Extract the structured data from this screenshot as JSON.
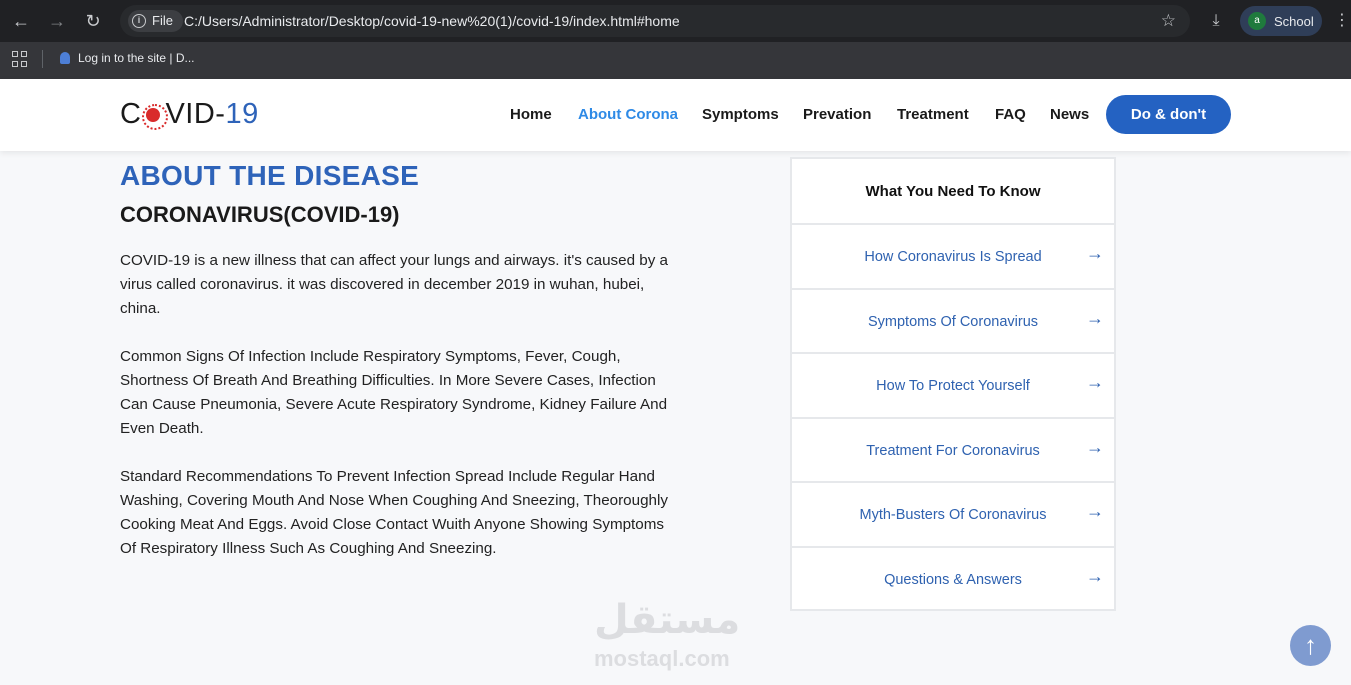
{
  "browser": {
    "site_chip": "File",
    "url": "C:/Users/Administrator/Desktop/covid-19-new%20(1)/covid-19/index.html#home",
    "profile_initial": "a",
    "profile_name": "School",
    "bookmark": "Log in to the site | D..."
  },
  "header": {
    "logo_prefix": "C",
    "logo_mid": "VID-",
    "logo_suffix": "19",
    "nav": [
      "Home",
      "About Corona",
      "Symptoms",
      "Prevation",
      "Treatment",
      "FAQ",
      "News"
    ],
    "active_nav": "About Corona",
    "cta": "Do & don't"
  },
  "main": {
    "heading": "ABOUT THE DISEASE",
    "subheading": "CORONAVIRUS(COVID-19)",
    "paragraphs": [
      "COVID-19 is a new illness that can affect your lungs and airways. it's caused by a virus called coronavirus. it was discovered in december 2019 in wuhan, hubei, china.",
      "Common Signs Of Infection Include Respiratory Symptoms, Fever, Cough, Shortness Of Breath And Breathing Difficulties. In More Severe Cases, Infection Can Cause Pneumonia, Severe Acute Respiratory Syndrome, Kidney Failure And Even Death.",
      "Standard Recommendations To Prevent Infection Spread Include Regular Hand Washing, Covering Mouth And Nose When Coughing And Sneezing, Theoroughly Cooking Meat And Eggs. Avoid Close Contact Wuith Anyone Showing Symptoms Of Respiratory Illness Such As Coughing And Sneezing."
    ]
  },
  "sidebar": {
    "title": "What You Need To Know",
    "items": [
      "How Coronavirus Is Spread",
      "Symptoms Of Coronavirus",
      "How To Protect Yourself",
      "Treatment For Coronavirus",
      "Myth-Busters Of Coronavirus",
      "Questions & Answers"
    ]
  },
  "watermark": {
    "arabic": "مستقل",
    "latin": "mostaql.com"
  },
  "icons": {
    "back": "back-arrow-icon",
    "forward": "forward-arrow-icon",
    "reload": "reload-icon",
    "scroll_top": "arrow-up-icon"
  }
}
